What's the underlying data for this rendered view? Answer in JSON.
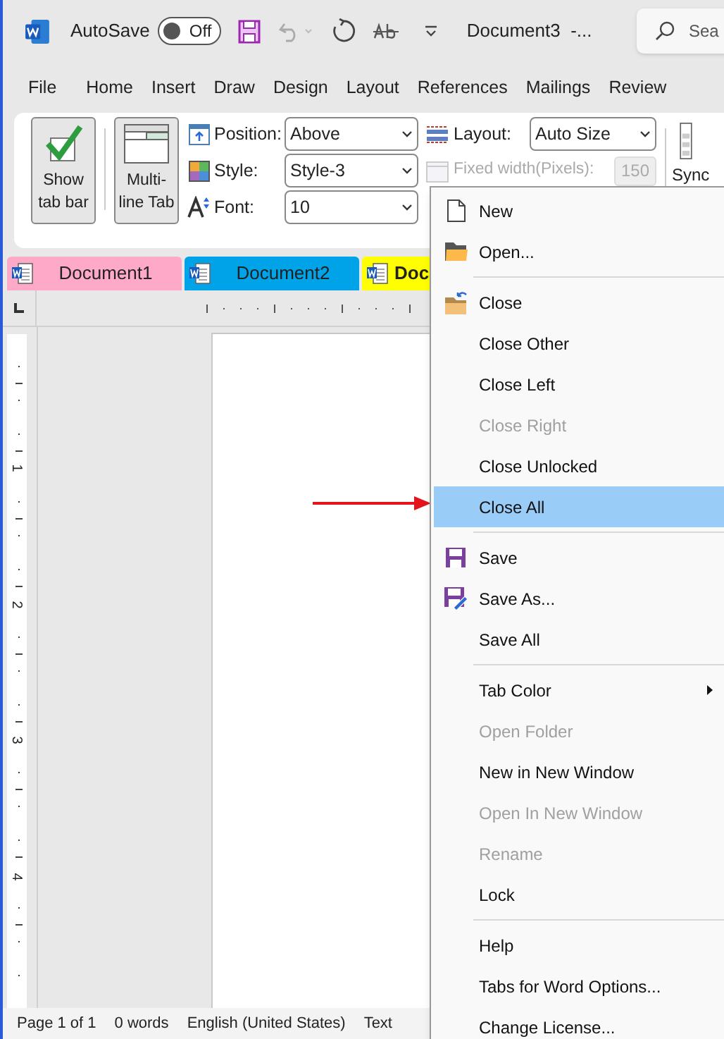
{
  "title_bar": {
    "autosave_label": "AutoSave",
    "autosave_toggle": {
      "label": "Off",
      "on": false
    },
    "document_title": "Document3  -...",
    "search_placeholder": "Sea"
  },
  "menu_tabs": [
    "File",
    "Home",
    "Insert",
    "Draw",
    "Design",
    "Layout",
    "References",
    "Mailings",
    "Review"
  ],
  "ribbon": {
    "toggle_buttons": [
      {
        "label": "Show tab bar",
        "on": true
      },
      {
        "label": "Multi-line Tab",
        "on": true
      }
    ],
    "fields": [
      {
        "label": "Position:",
        "value": "Above"
      },
      {
        "label": "Style:",
        "value": "Style-3"
      },
      {
        "label": "Font:",
        "value": "10"
      }
    ],
    "layout_field": {
      "label": "Layout:",
      "value": "Auto Size"
    },
    "fixed_width": {
      "label": "Fixed width(Pixels):",
      "value": "150",
      "disabled": true
    },
    "sync_label": "Sync"
  },
  "document_tabs": [
    {
      "label": "Document1",
      "color": "#ffa9c8",
      "selected": false
    },
    {
      "label": "Document2",
      "color": "#00a2e8",
      "selected": false
    },
    {
      "label": "Doc",
      "color": "#ffff00",
      "selected": true
    }
  ],
  "vertical_ruler_numbers": [
    "1",
    "2",
    "3",
    "4"
  ],
  "status_bar": [
    "Page 1 of 1",
    "0 words",
    "English (United States)",
    "Text"
  ],
  "context_menu": [
    {
      "kind": "item",
      "label": "New",
      "disabled": false,
      "selected": false
    },
    {
      "kind": "item",
      "label": "Open...",
      "disabled": false,
      "selected": false
    },
    {
      "kind": "separator"
    },
    {
      "kind": "item",
      "label": "Close",
      "disabled": false,
      "selected": false
    },
    {
      "kind": "item",
      "label": "Close Other",
      "disabled": false,
      "selected": false
    },
    {
      "kind": "item",
      "label": "Close Left",
      "disabled": false,
      "selected": false
    },
    {
      "kind": "item",
      "label": "Close Right",
      "disabled": true,
      "selected": false
    },
    {
      "kind": "item",
      "label": "Close Unlocked",
      "disabled": false,
      "selected": false
    },
    {
      "kind": "item",
      "label": "Close All",
      "disabled": false,
      "selected": true
    },
    {
      "kind": "separator"
    },
    {
      "kind": "item",
      "label": "Save",
      "disabled": false,
      "selected": false
    },
    {
      "kind": "item",
      "label": "Save As...",
      "disabled": false,
      "selected": false
    },
    {
      "kind": "item",
      "label": "Save All",
      "disabled": false,
      "selected": false
    },
    {
      "kind": "separator"
    },
    {
      "kind": "submenu",
      "label": "Tab Color",
      "disabled": false,
      "selected": false
    },
    {
      "kind": "item",
      "label": "Open Folder",
      "disabled": true,
      "selected": false
    },
    {
      "kind": "item",
      "label": "New in New Window",
      "disabled": false,
      "selected": false
    },
    {
      "kind": "item",
      "label": "Open In New Window",
      "disabled": true,
      "selected": false
    },
    {
      "kind": "item",
      "label": "Rename",
      "disabled": true,
      "selected": false
    },
    {
      "kind": "item",
      "label": "Lock",
      "disabled": false,
      "selected": false
    },
    {
      "kind": "separator"
    },
    {
      "kind": "item",
      "label": "Help",
      "disabled": false,
      "selected": false
    },
    {
      "kind": "item",
      "label": "Tabs for Word Options...",
      "disabled": false,
      "selected": false
    },
    {
      "kind": "item",
      "label": "Change License...",
      "disabled": false,
      "selected": false
    }
  ]
}
